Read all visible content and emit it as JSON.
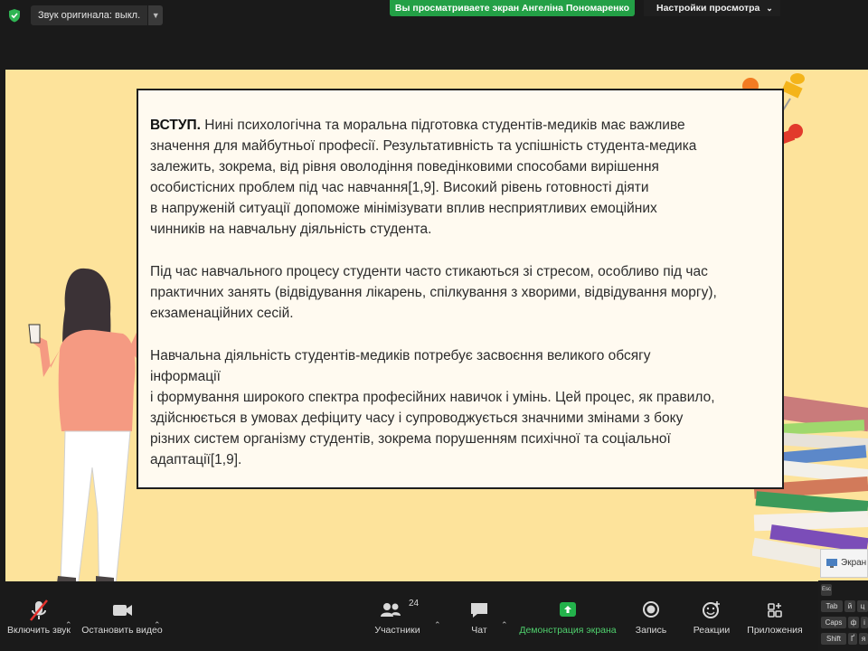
{
  "top_bar": {
    "original_audio": "Звук оригинала: выкл.",
    "share_banner": "Вы просматриваете экран Ангеліна Пономаренко",
    "view_settings": "Настройки просмотра"
  },
  "slide": {
    "p1_heading": "ВСТУП.",
    "p1_lines": [
      " Нині психологічна та моральна підготовка студентів-медиків має важливе",
      "значення для майбутньої професії. Результативність та успішність студента-медика",
      "залежить, зокрема, від рівня оволодіння поведінковими способами вирішення",
      "особистісних проблем під час навчання[1,9]. Високий рівень готовності діяти",
      "в напруженій ситуації допоможе мінімізувати вплив несприятливих емоційних",
      "чинників на навчальну діяльність студента."
    ],
    "p2_lines": [
      "Під час навчального процесу студенти часто стикаються зі стресом, особливо під час",
      "практичних занять (відвідування лікарень, спілкування з хворими, відвідування моргу),",
      "екзаменаційних сесій."
    ],
    "p3_lines": [
      "Навчальна діяльність студентів-медиків потребує засвоєння великого обсягу",
      "інформації",
      "і формування широкого спектра професійних навичок і умінь. Цей процес, як правило,",
      "здійснюється в умовах дефіциту часу і супроводжується значними змінами з боку",
      "різних систем організму студентів, зокрема порушенням психічної та соціальної",
      "адаптації[1,9]."
    ]
  },
  "toolbar": {
    "mute": "Включить звук",
    "video": "Остановить видео",
    "participants": "Участники",
    "participants_count": "24",
    "chat": "Чат",
    "share": "Демонстрация экрана",
    "record": "Запись",
    "reactions": "Реакции",
    "apps": "Приложения"
  },
  "side_panel": {
    "label": "Экран"
  },
  "keyboard": {
    "tab": "Tab",
    "caps": "Caps",
    "shift": "Shift",
    "k1": "й",
    "k2": "ц",
    "k3": "ф",
    "k4": "і",
    "k5": "Ґ",
    "k6": "я",
    "esc": "Esc"
  },
  "colors": {
    "slide_bg": "#fde39b",
    "share_green": "#23a046",
    "textbox_bg": "#fffaf0"
  }
}
